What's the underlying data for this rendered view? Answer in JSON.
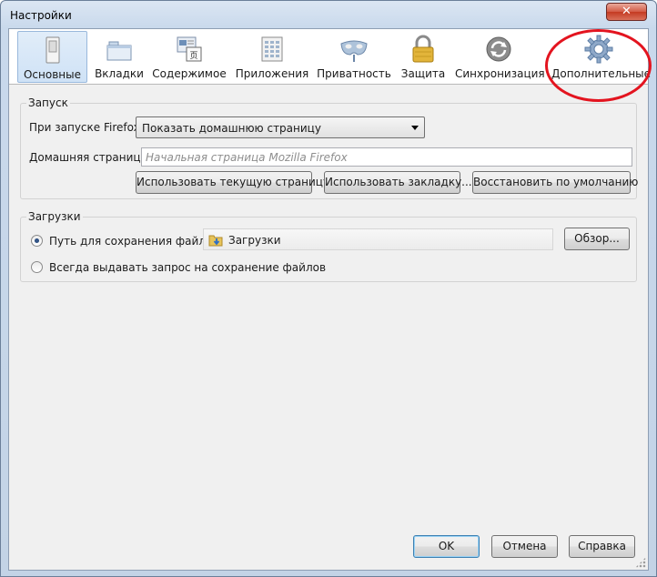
{
  "window": {
    "title": "Настройки",
    "close_label": "✕"
  },
  "tabs": [
    {
      "label": "Основные",
      "icon": "switch-icon",
      "selected": true
    },
    {
      "label": "Вкладки",
      "icon": "tabs-icon",
      "selected": false
    },
    {
      "label": "Содержимое",
      "icon": "content-icon",
      "selected": false
    },
    {
      "label": "Приложения",
      "icon": "applications-icon",
      "selected": false
    },
    {
      "label": "Приватность",
      "icon": "privacy-mask-icon",
      "selected": false
    },
    {
      "label": "Защита",
      "icon": "lock-icon",
      "selected": false
    },
    {
      "label": "Синхронизация",
      "icon": "sync-icon",
      "selected": false
    },
    {
      "label": "Дополнительные",
      "icon": "gear-icon",
      "selected": false
    }
  ],
  "startup": {
    "caption": "Запуск",
    "when_starts_label": "При запуске Firefox:",
    "when_starts_value": "Показать домашнюю страницу",
    "homepage_label": "Домашняя страница:",
    "homepage_placeholder": "Начальная страница Mozilla Firefox",
    "homepage_value": "",
    "use_current_button": "Использовать текущую страницу",
    "use_bookmark_button": "Использовать закладку...",
    "restore_default_button": "Восстановить по умолчанию"
  },
  "downloads": {
    "caption": "Загрузки",
    "save_to_label": "Путь для сохранения файлов",
    "folder_name": "Загрузки",
    "browse_button": "Обзор...",
    "always_ask_label": "Всегда выдавать запрос на сохранение файлов",
    "save_to_selected": true
  },
  "footer": {
    "ok_button": "OK",
    "cancel_button": "Отмена",
    "help_button": "Справка"
  },
  "colors": {
    "annotation_circle": "#e3141f",
    "selected_tab": "#cfe2f6",
    "close_button": "#c43a22"
  }
}
